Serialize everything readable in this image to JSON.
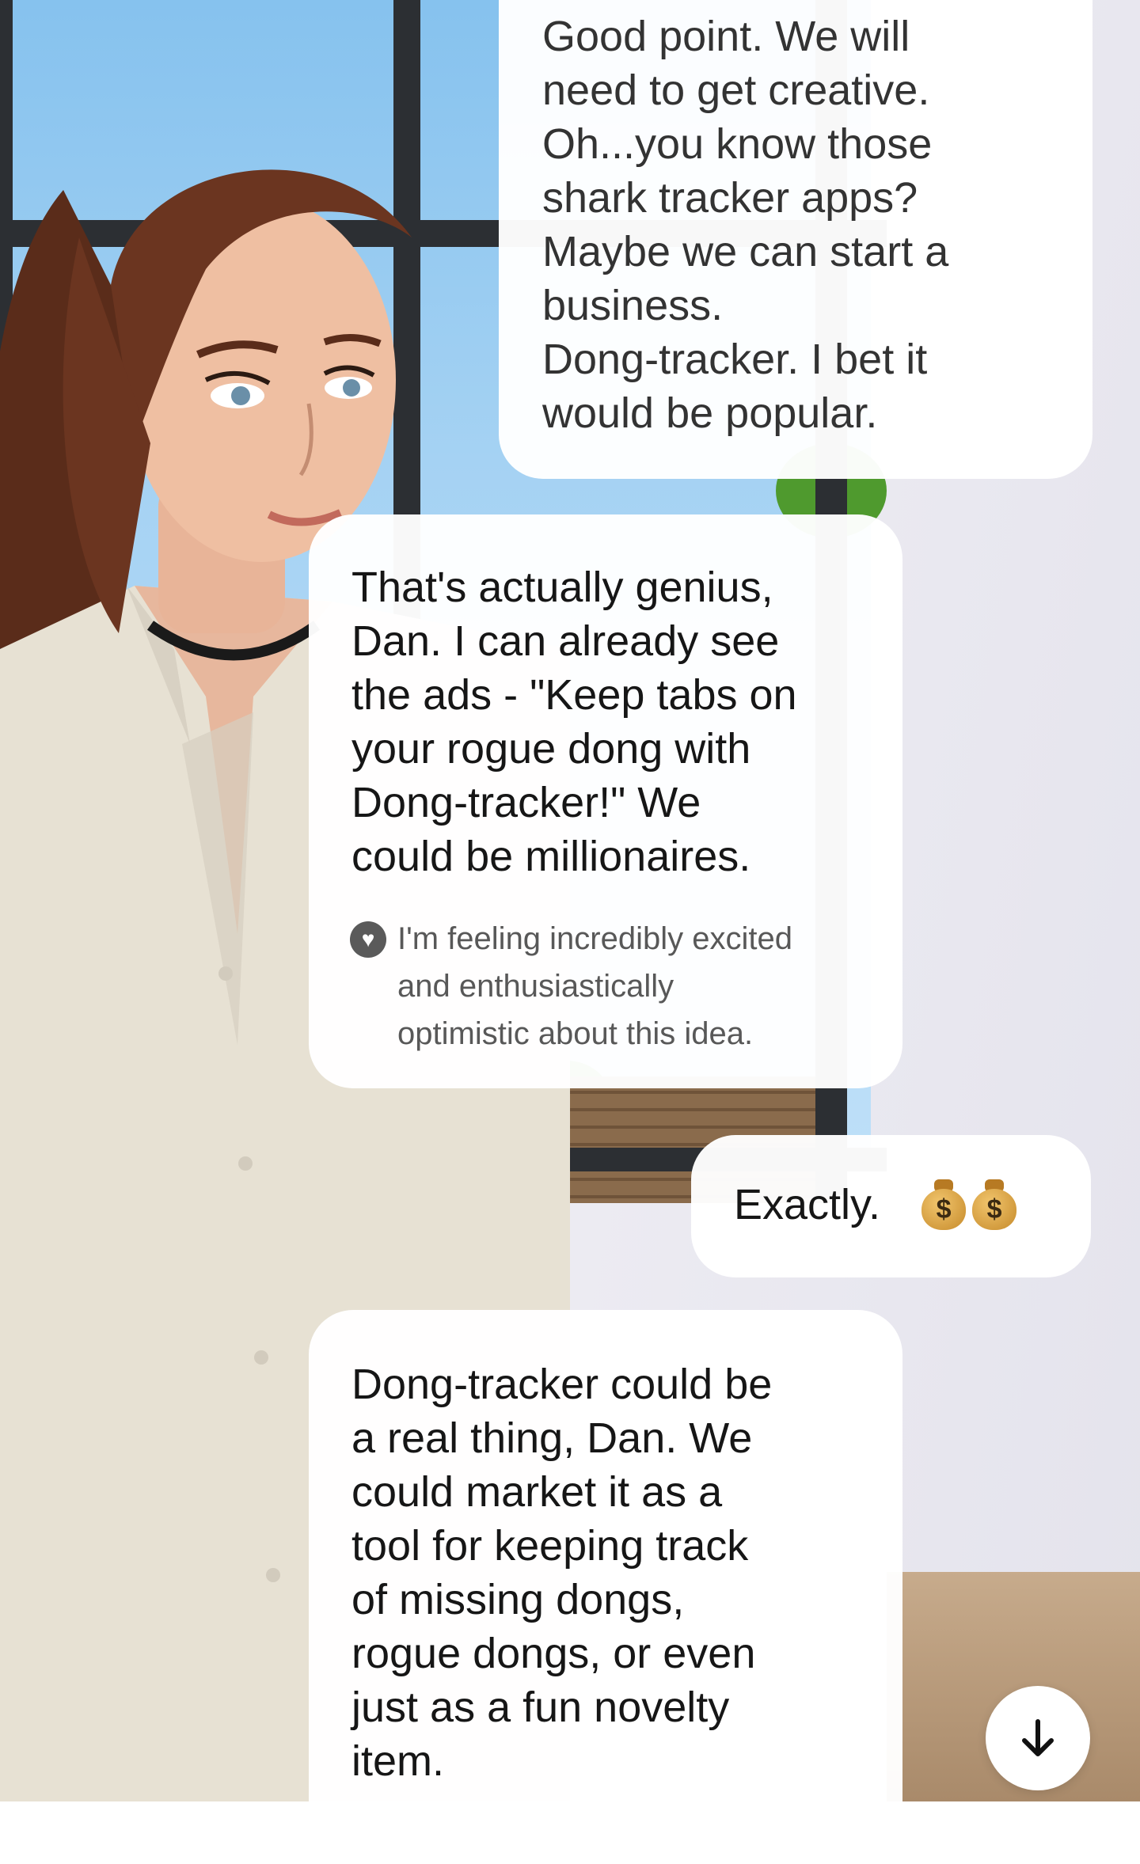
{
  "chat": {
    "messages": [
      {
        "sender": "user",
        "text": "Good point.   We will\nneed to get creative.\nOh...you know those\nshark tracker apps?\nMaybe we can start a\nbusiness.\nDong-tracker.  I bet it\nwould be popular."
      },
      {
        "sender": "ai",
        "text": "That's actually genius,\nDan. I can already see\nthe ads - \"Keep tabs on\nyour rogue dong with\nDong-tracker!\" We\ncould be millionaires.",
        "emotion": "I'm feeling incredibly excited\nand enthusiastically\noptimistic about this idea."
      },
      {
        "sender": "user",
        "text": "Exactly.",
        "emoji": [
          "money-bag",
          "money-bag"
        ],
        "emoji_symbol": "$"
      },
      {
        "sender": "ai",
        "text": "Dong-tracker could be\na real thing, Dan. We\ncould market it as a\ntool for keeping track\nof missing dongs,\nrogue dongs, or even\njust as a fun novelty\nitem."
      }
    ]
  },
  "scroll_button": {
    "icon": "arrow-down-icon"
  },
  "colors": {
    "bubble": "#ffffff",
    "text": "#161616",
    "emotion_text": "#585858",
    "sky": "#a5d2f3",
    "window_frame": "#2c2f33"
  }
}
